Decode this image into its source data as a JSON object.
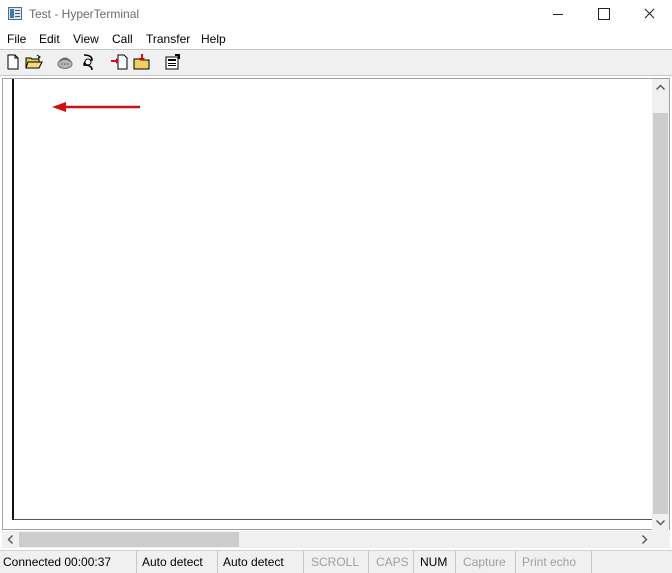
{
  "window": {
    "title": "Test - HyperTerminal"
  },
  "menu": {
    "items": [
      "File",
      "Edit",
      "View",
      "Call",
      "Transfer",
      "Help"
    ]
  },
  "toolbar": {
    "icons": [
      "new-document-icon",
      "open-folder-icon",
      "phone-call-icon",
      "disconnect-icon",
      "send-file-icon",
      "receive-file-icon",
      "properties-icon"
    ]
  },
  "annotation": {
    "arrow_color": "#d01010"
  },
  "statusbar": {
    "connection": "Connected 00:00:37",
    "detect1": "Auto detect",
    "detect2": "Auto detect",
    "scroll": "SCROLL",
    "caps": "CAPS",
    "num": "NUM",
    "capture": "Capture",
    "print_echo": "Print echo"
  }
}
